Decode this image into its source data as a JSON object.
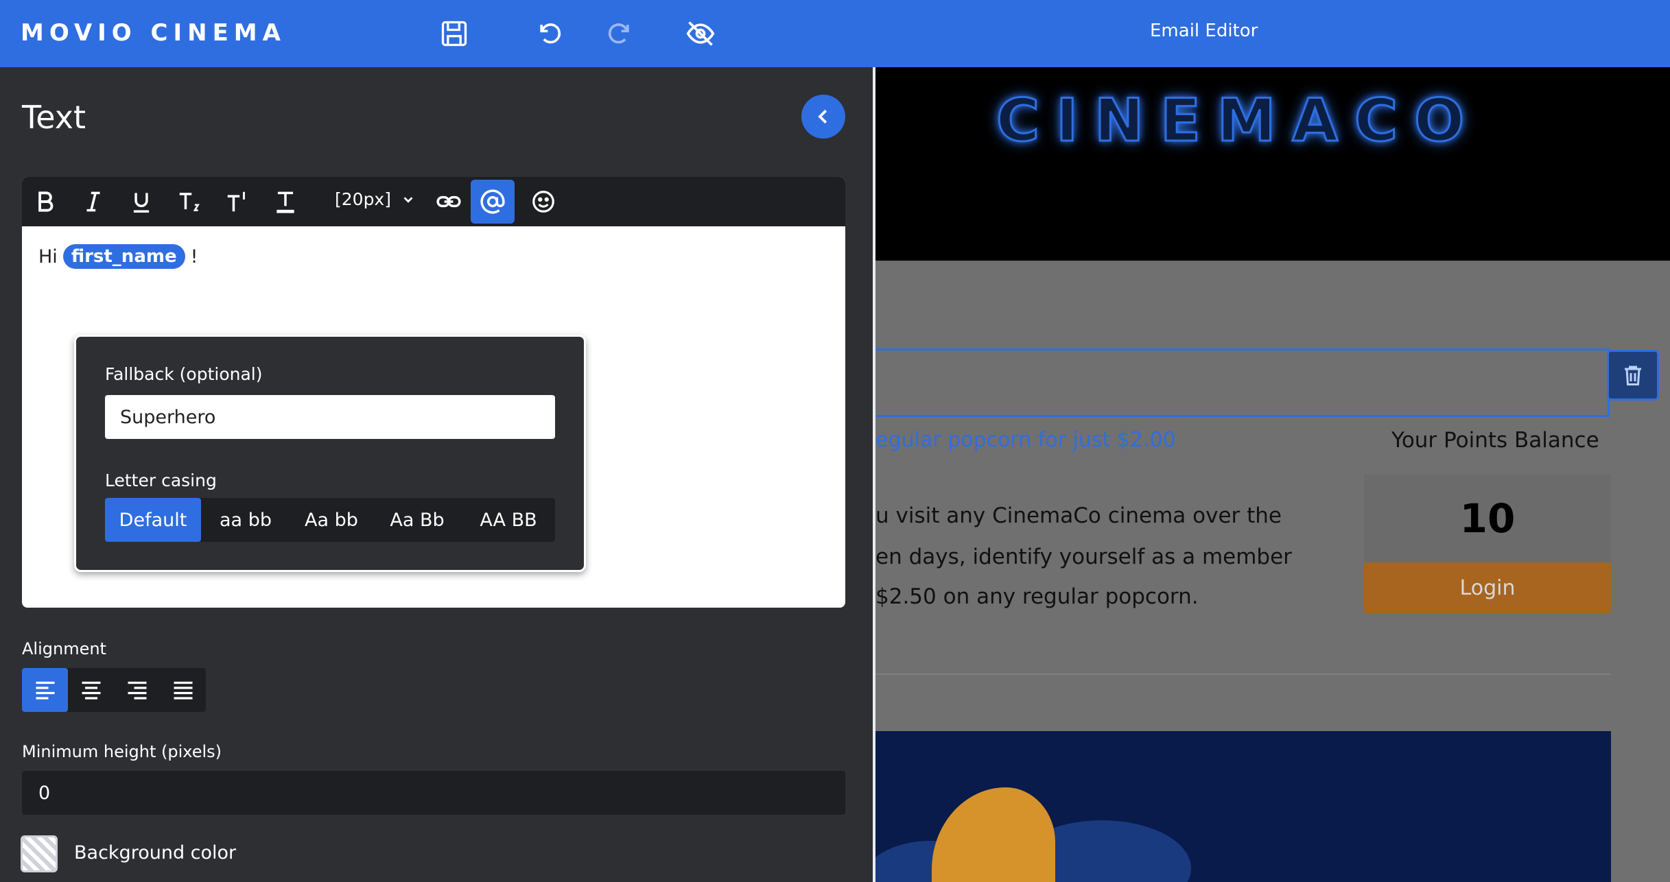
{
  "topbar": {
    "brand": "MOVIO CINEMA",
    "title": "Email Editor"
  },
  "panel": {
    "title": "Text",
    "toolbar": {
      "font_size": "[20px]"
    },
    "editor": {
      "greeting": "Hi",
      "token": "first_name",
      "suffix": "!"
    },
    "popover": {
      "fallback_label": "Fallback (optional)",
      "fallback_value": "Superhero",
      "casing_label": "Letter casing",
      "casing_options": [
        "Default",
        "aa bb",
        "Aa bb",
        "Aa Bb",
        "AA BB"
      ],
      "casing_selected": "Default"
    },
    "alignment_label": "Alignment",
    "alignment_selected": "left",
    "min_height_label": "Minimum height (pixels)",
    "min_height_value": "0",
    "bg_color_label": "Background color"
  },
  "preview": {
    "logo": "CINEMACO",
    "offer_text": "egular popcorn for just $2.00",
    "points_heading": "Your Points Balance",
    "body_lines": [
      "u visit any CinemaCo cinema over the",
      "en days, identify yourself as a member",
      " $2.50 on any regular popcorn."
    ],
    "points_value": "10",
    "login_label": "Login"
  },
  "colors": {
    "accent": "#2f6ee0",
    "panel_bg": "#2e2f33",
    "toolbar_bg": "#1e1f22",
    "login_bg": "#a8651f"
  }
}
